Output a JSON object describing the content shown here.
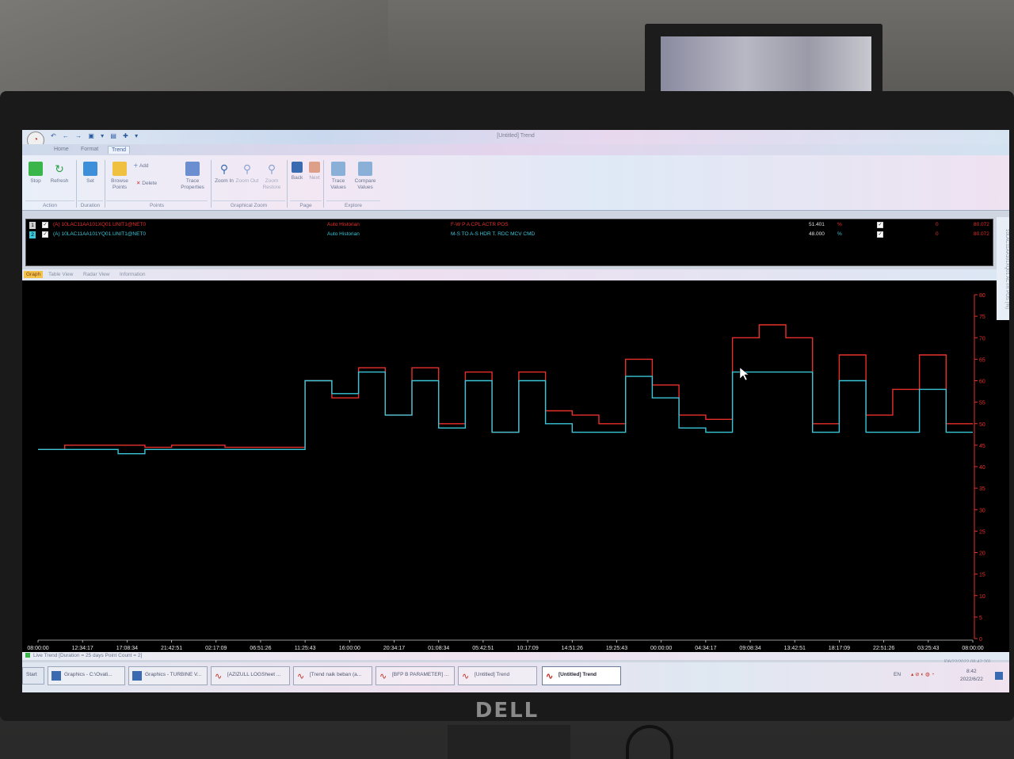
{
  "app": {
    "window_title": "[Untitled] Trend"
  },
  "ribbon_tabs": [
    "Home",
    "Format",
    "Trend"
  ],
  "ribbon": {
    "stop": "Stop",
    "refresh": "Refresh",
    "set": "Set",
    "browse_points": "Browse Points",
    "add": "Add",
    "delete": "Delete",
    "trace_properties": "Trace Properties",
    "zoom_in": "Zoom In",
    "zoom_out": "Zoom Out",
    "zoom_restore": "Zoom Restore",
    "back": "Back",
    "next": "Next",
    "trace_values": "Trace Values",
    "compare_values": "Compare Values",
    "groups": {
      "action": "Action",
      "duration": "Duration",
      "points": "Points",
      "graphical_zoom": "Graphical Zoom",
      "page": "Page",
      "explore": "Explore"
    }
  },
  "points": [
    {
      "index": "1",
      "tag": "(A) 10LAC11AA101XQ01.UNIT1@NET0",
      "source": "Auto Historian",
      "description": "F-W P A CPL ACTR POS",
      "value": "51.401",
      "unit": "%",
      "offset": "0",
      "scale_max": "80.072",
      "color": "#e8302a"
    },
    {
      "index": "2",
      "tag": "(A) 10LAC11AA101YQ01.UNIT1@NET0",
      "source": "Auto Historian",
      "description": "M-S TO A-S HDR T. RDC MCV CMD",
      "value": "48.000",
      "unit": "%",
      "offset": "0",
      "scale_max": "80.072",
      "color": "#39c6d8"
    }
  ],
  "side_label": "10LAC11AA101XQ01 ACTR POS (%)",
  "view_tabs": [
    "Graph",
    "Table View",
    "Radar View",
    "Information"
  ],
  "chart_data": {
    "type": "line",
    "x_tick_labels": [
      "08:00:00",
      "12:34:17",
      "17:08:34",
      "21:42:51",
      "02:17:09",
      "06:51:26",
      "11:25:43",
      "16:00:00",
      "20:34:17",
      "01:08:34",
      "05:42:51",
      "10:17:09",
      "14:51:26",
      "19:25:43",
      "00:00:00",
      "04:34:17",
      "09:08:34",
      "13:42:51",
      "18:17:09",
      "22:51:26",
      "03:25:43",
      "08:00:00"
    ],
    "y_tick_labels": [
      "80",
      "75",
      "70",
      "65",
      "60",
      "55",
      "50",
      "45",
      "40",
      "35",
      "30",
      "25",
      "20",
      "15",
      "10",
      "5",
      "0"
    ],
    "ylim": [
      0,
      80
    ],
    "series": [
      {
        "name": "F-W P A CPL ACTR POS",
        "color": "#e8302a",
        "values": [
          44,
          45,
          45,
          45,
          44.5,
          45,
          45,
          44.5,
          44.5,
          44.5,
          60,
          56,
          63,
          52,
          63,
          50,
          62,
          48,
          62,
          53,
          52,
          50,
          65,
          59,
          52,
          51,
          70,
          73,
          70,
          50,
          66,
          52,
          58,
          66,
          50
        ]
      },
      {
        "name": "M-S TO A-S HDR T. RDC MCV CMD",
        "color": "#39c6d8",
        "values": [
          44,
          44,
          44,
          43,
          44,
          44,
          44,
          44,
          44,
          44,
          60,
          57,
          62,
          52,
          60,
          49,
          60,
          48,
          60,
          50,
          48,
          48,
          61,
          56,
          49,
          48,
          62,
          62,
          62,
          48,
          60,
          48,
          48,
          58,
          48
        ]
      }
    ]
  },
  "status": {
    "live_trend": "Live Trend [Duration = 25 days  Point Count = 2]",
    "timestamp": "[06/22/2022 08:42:20]"
  },
  "taskbar": {
    "start": "Start",
    "tasks": [
      "Graphics - C:\\Ovati...",
      "Graphics - TURBINE V...",
      "[AZIZULL LOGSheet ...",
      "[Trend naik beban (a...",
      "[BFP B PARAMETER] ...",
      "[Untitled] Trend",
      "[Untitled] Trend"
    ],
    "lang": "EN",
    "clock_time": "8:42",
    "clock_date": "2022/6/22"
  },
  "brand": "DELL"
}
